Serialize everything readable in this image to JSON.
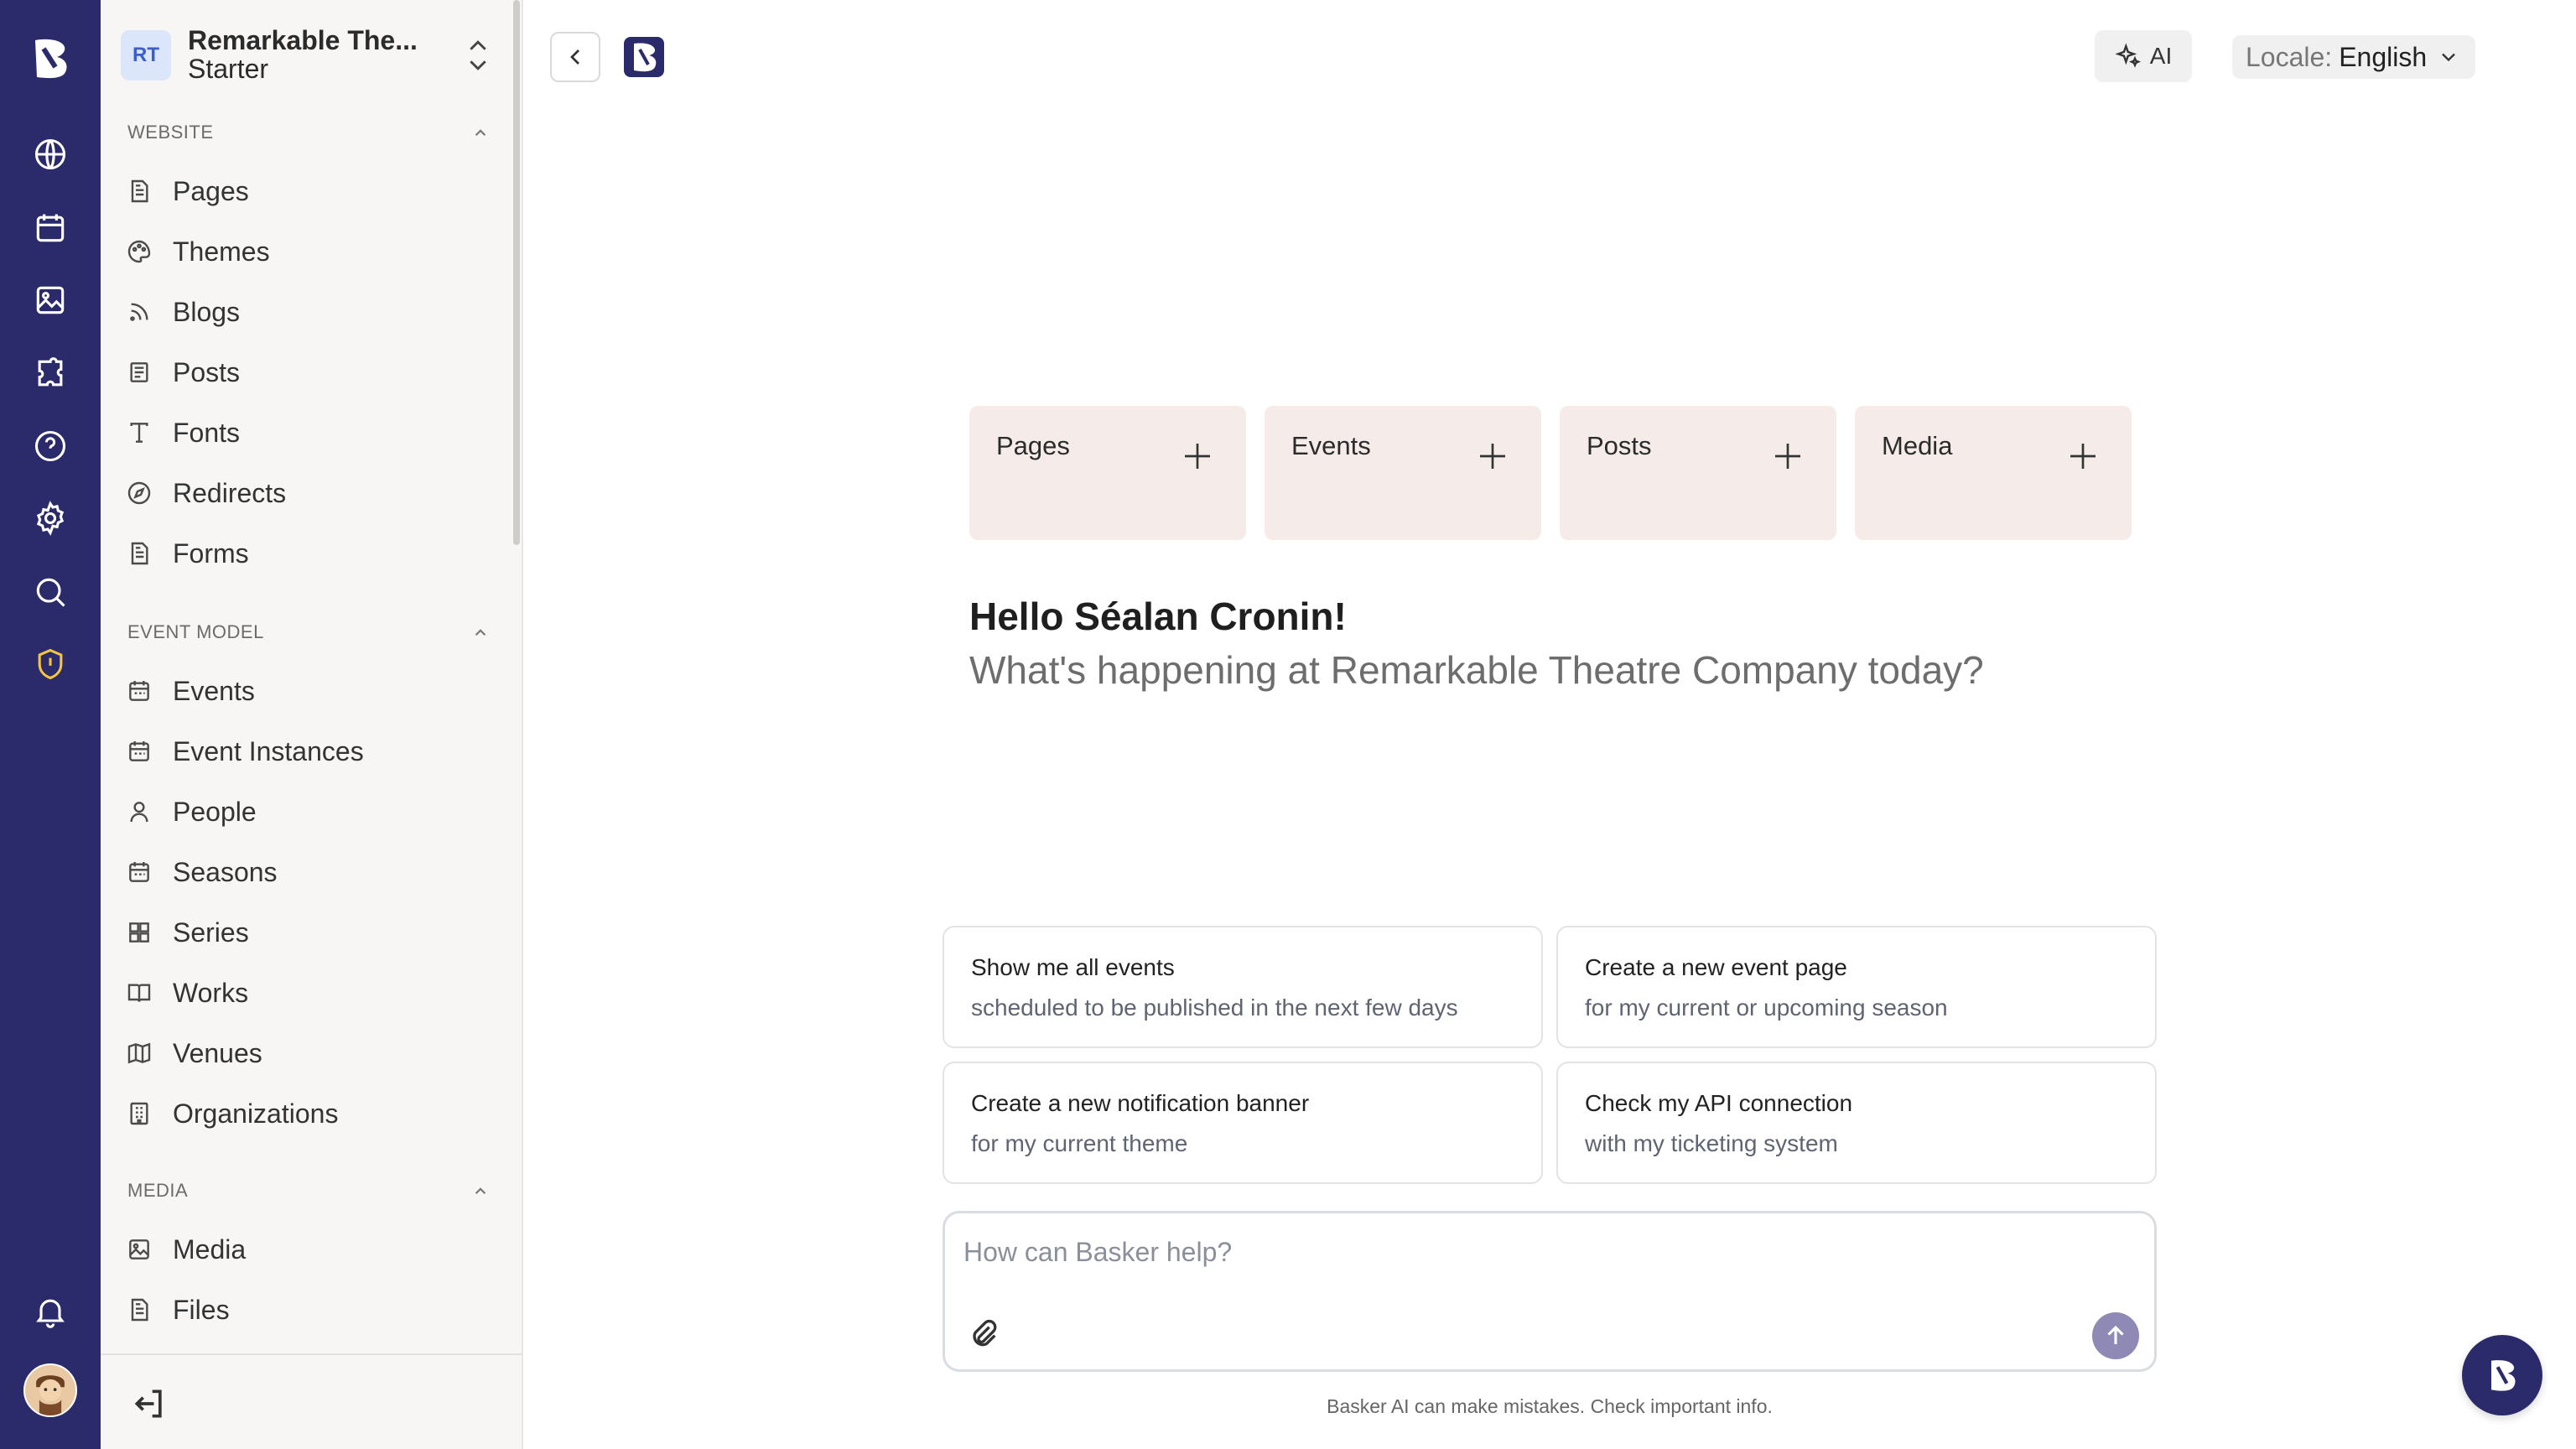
{
  "org": {
    "initials": "RT",
    "name": "Remarkable The...",
    "plan": "Starter"
  },
  "sidebar": {
    "sections": [
      {
        "title": "WEBSITE",
        "items": [
          "Pages",
          "Themes",
          "Blogs",
          "Posts",
          "Fonts",
          "Redirects",
          "Forms"
        ]
      },
      {
        "title": "EVENT MODEL",
        "items": [
          "Events",
          "Event Instances",
          "People",
          "Seasons",
          "Series",
          "Works",
          "Venues",
          "Organizations"
        ]
      },
      {
        "title": "MEDIA",
        "items": [
          "Media",
          "Files"
        ]
      }
    ]
  },
  "rail": {
    "icons": [
      "globe-icon",
      "calendar-icon",
      "image-icon",
      "puzzle-icon",
      "help-icon",
      "gear-icon",
      "search-icon",
      "shield-icon",
      "bell-icon"
    ]
  },
  "topbar": {
    "ai_label": "AI",
    "locale_key": "Locale:",
    "locale_value": "English"
  },
  "tiles": [
    "Pages",
    "Events",
    "Posts",
    "Media"
  ],
  "greeting": {
    "hello": "Hello Séalan Cronin!",
    "question": "What's happening at Remarkable Theatre Company today?"
  },
  "suggestions": [
    {
      "title": "Show me all events",
      "sub": "scheduled to be published in the next few days"
    },
    {
      "title": "Create a new event page",
      "sub": "for my current or upcoming season"
    },
    {
      "title": "Create a new notification banner",
      "sub": "for my current theme"
    },
    {
      "title": "Check my API connection",
      "sub": "with my ticketing system"
    }
  ],
  "chat": {
    "placeholder": "How can Basker help?",
    "disclaimer": "Basker AI can make mistakes. Check important info."
  },
  "colors": {
    "rail": "#2b2a6b",
    "tile": "#f5ebe8",
    "send": "#8e8ab5",
    "warn": "#f5c542"
  }
}
